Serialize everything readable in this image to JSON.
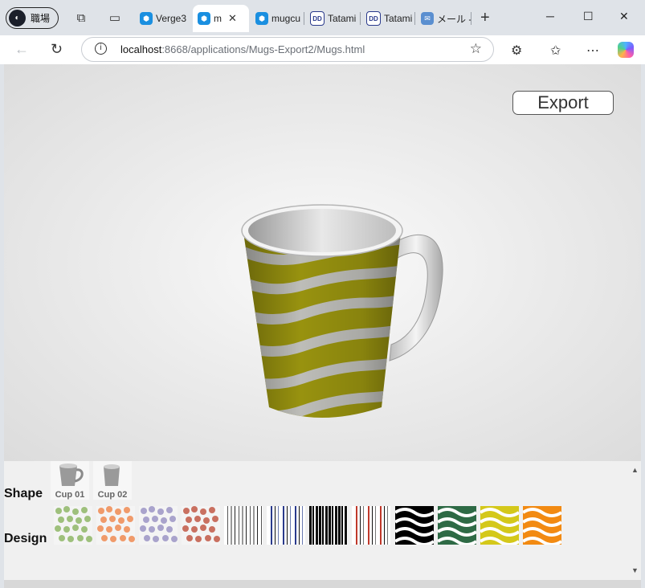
{
  "browser": {
    "profile_label": "職場",
    "tabs": [
      {
        "label": "Verge3",
        "favicon": "verge3d-icon",
        "active": false
      },
      {
        "label": "m",
        "favicon": "verge3d-icon",
        "active": true
      },
      {
        "label": "mugcu",
        "favicon": "verge3d-icon",
        "active": false
      },
      {
        "label": "Tatami",
        "favicon": "ddverse-icon",
        "active": false
      },
      {
        "label": "Tatami",
        "favicon": "ddverse-icon",
        "active": false
      },
      {
        "label": "メール -",
        "favicon": "outlook-icon",
        "active": false
      }
    ],
    "url_host": "localhost",
    "url_rest": ":8668/applications/Mugs-Export2/Mugs.html"
  },
  "app": {
    "export_label": "Export",
    "mug_color": "#a09a10",
    "shape_label": "Shape",
    "design_label": "Design",
    "shapes": [
      {
        "label": "Cup 01"
      },
      {
        "label": "Cup 02"
      }
    ],
    "designs": [
      {
        "name": "green-dots"
      },
      {
        "name": "orange-dots"
      },
      {
        "name": "purple-dots"
      },
      {
        "name": "red-dots"
      },
      {
        "name": "gray-stripes"
      },
      {
        "name": "blue-stripes"
      },
      {
        "name": "black-stripes"
      },
      {
        "name": "red-stripes"
      },
      {
        "name": "black-waves"
      },
      {
        "name": "green-waves"
      },
      {
        "name": "yellow-waves"
      },
      {
        "name": "orange-waves"
      }
    ]
  }
}
